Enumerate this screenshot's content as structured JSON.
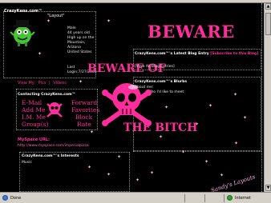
{
  "profile": {
    "brand": "CrazyKens.com™",
    "nickname": "\"Layout\"",
    "gender": "Male",
    "age": "44 years old",
    "location_line1": "High up on the",
    "location_line2": "Mountain,",
    "location_line3": "Arizona",
    "country": "United States",
    "last_label": "Last",
    "last_login": "Login:7/27/2006"
  },
  "view_links": {
    "prefix": "View My:",
    "pics": "Pics",
    "separator": "|",
    "videos": "Videos"
  },
  "contact": {
    "title": "Contacting CrazyKens.com™",
    "email": "E-Mail",
    "forward": "Forward",
    "add_me": "Add Me",
    "favorites": "Favorites",
    "im_me": "I.M. Me",
    "block": "Block",
    "groups": "Group(s)",
    "rate": "Rate"
  },
  "myspace": {
    "title": "MySpace URL:",
    "url": "http://www.myspace.com/imperialpizza"
  },
  "interests": {
    "title": "CrazyKens.com™'s Interests",
    "music_label": "Music"
  },
  "banner": {
    "beware": "BEWARE",
    "beware_of": "BEWARE OF",
    "the_bitch": "THE BITCH"
  },
  "blog": {
    "title": "CrazyKens.com™'s Latest Blog Entry",
    "subscribe": "[Subscribe to this Blog]",
    "entry": "[View All Blog Entries]"
  },
  "blurbs": {
    "title": "CrazyKens.com™'s Blurbs",
    "about": "About me:",
    "meet": "Who I'd like to meet:"
  },
  "signature": "Sandy's Layouts",
  "statusbar": {
    "done": "Done",
    "zone": "Internet"
  },
  "colors": {
    "accent_pink": "#ff2d9b",
    "background": "#000000"
  }
}
